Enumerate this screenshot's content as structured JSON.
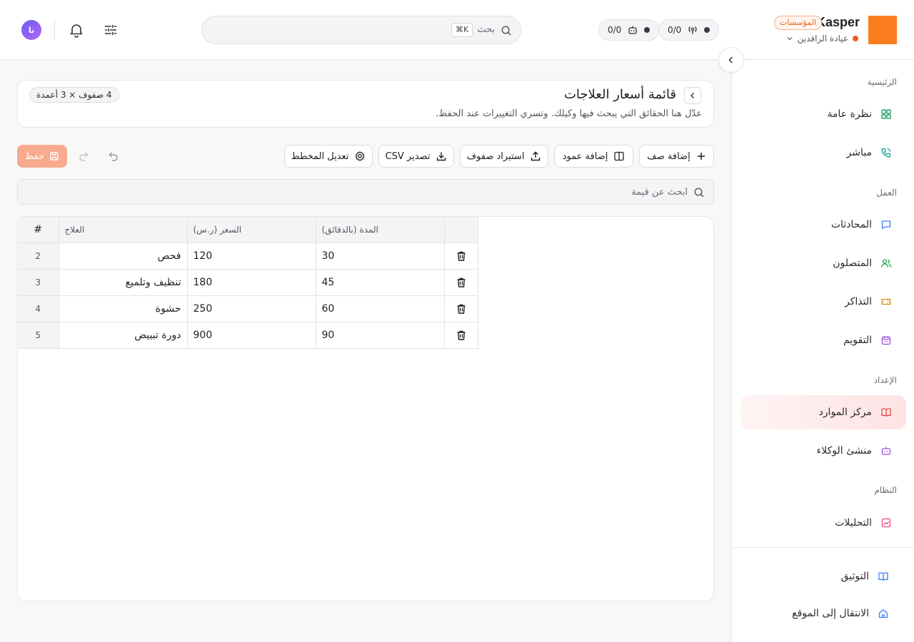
{
  "header": {
    "brand_name": "Kasper",
    "brand_badge": "المؤسسات",
    "workspace_name": "عيادة الرافدين",
    "counter_broadcast": "0/0",
    "counter_bot": "0/0",
    "search_placeholder": "بحث",
    "search_shortcut": "⌘K",
    "avatar_initials": "نا"
  },
  "sidebar": {
    "sections": [
      {
        "label": "الرئيسية",
        "items": [
          {
            "label": "نظرة عامة",
            "icon": "grid-icon",
            "color": "#22a06b"
          },
          {
            "label": "مباشر",
            "icon": "phone-icon",
            "color": "#0e9f8e"
          }
        ]
      },
      {
        "label": "العمل",
        "items": [
          {
            "label": "المحادثات",
            "icon": "chat-icon",
            "color": "#3b82f6"
          },
          {
            "label": "المتصلون",
            "icon": "users-icon",
            "color": "#22a04b"
          },
          {
            "label": "التذاكر",
            "icon": "ticket-icon",
            "color": "#e08a1e"
          },
          {
            "label": "التقويم",
            "icon": "calendar-icon",
            "color": "#9b51e0"
          }
        ]
      },
      {
        "label": "الإعداد",
        "items": [
          {
            "label": "مركز الموارد",
            "icon": "book-icon",
            "color": "#e5484d"
          },
          {
            "label": "منشئ الوكلاء",
            "icon": "bot-icon",
            "color": "#9b51e0"
          }
        ]
      },
      {
        "label": "النظام",
        "items": [
          {
            "label": "التحليلات",
            "icon": "analytics-icon",
            "color": "#e5487f"
          }
        ]
      }
    ],
    "footer": [
      {
        "label": "التوثيق",
        "icon": "docs-icon",
        "color": "#3b82f6"
      },
      {
        "label": "الانتقال إلى الموقع",
        "icon": "home-icon",
        "color": "#3b82f6"
      }
    ]
  },
  "page": {
    "title": "قائمة أسعار العلاجات",
    "description": "عدّل هنا الحقائق التي يبحث فيها وكيلك. وتسري التغييرات عند الحفظ.",
    "dimensions_badge": "4 صفوف × 3 أعمدة"
  },
  "toolbar": {
    "add_row": "إضافة صف",
    "add_column": "إضافة عمود",
    "import_rows": "استيراد صفوف",
    "export_csv": "تصدير CSV",
    "edit_schema": "تعديل المخطط",
    "save": "حفظ"
  },
  "value_search_placeholder": "ابحث عن قيمة",
  "table": {
    "headers": {
      "number": "#",
      "treatment": "العلاج",
      "price": "السعر (ر.س)",
      "duration": "المدة (بالدقائق)"
    },
    "rows": [
      {
        "num": "2",
        "treatment": "فحص",
        "price": "120",
        "duration": "30"
      },
      {
        "num": "3",
        "treatment": "تنظيف وتلميع",
        "price": "180",
        "duration": "45"
      },
      {
        "num": "4",
        "treatment": "حشوة",
        "price": "250",
        "duration": "60"
      },
      {
        "num": "5",
        "treatment": "دورة تبييض",
        "price": "900",
        "duration": "90"
      }
    ]
  },
  "colors": {
    "accent": "#fa7d1e",
    "save_disabled": "#f7aa8e",
    "active_nav": "#e5484d"
  }
}
